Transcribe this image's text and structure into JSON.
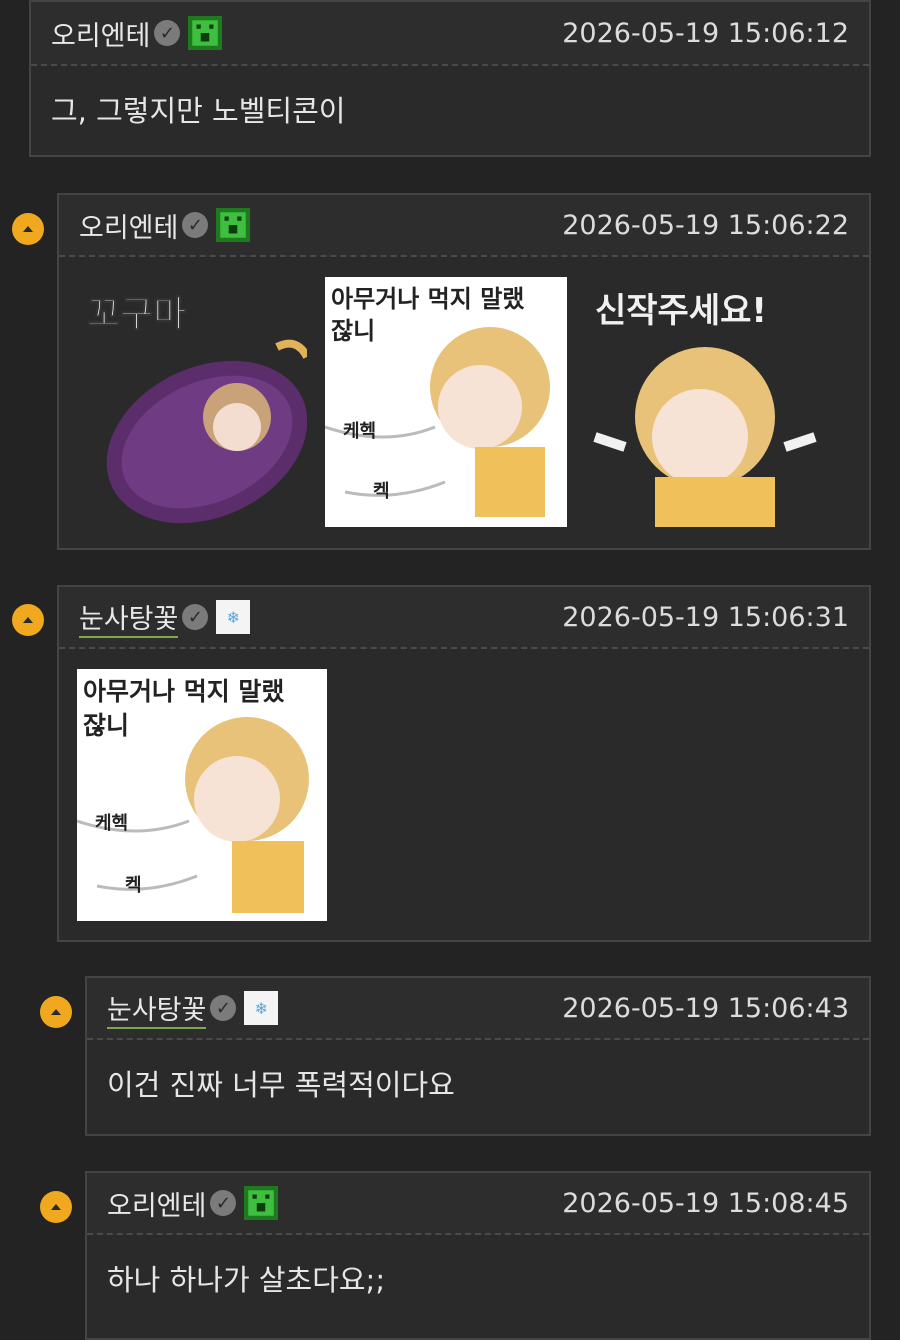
{
  "comments": [
    {
      "author": "오리엔테",
      "time": "2026-05-19 15:06:12",
      "text": "그, 그렇지만 노벨티콘이"
    },
    {
      "author": "오리엔테",
      "time": "2026-05-19 15:06:22",
      "stickers": [
        {
          "name": "sweet-potato-sticker",
          "label": "꼬구마"
        },
        {
          "name": "choking-sticker",
          "label": "아무거나 먹지 말랬잖니",
          "sfx1": "케헥",
          "sfx2": "켁"
        },
        {
          "name": "give-new-sticker",
          "label": "신작주세요!"
        }
      ]
    },
    {
      "author": "눈사탕꽃",
      "time": "2026-05-19 15:06:31",
      "stickers": [
        {
          "name": "choking-sticker",
          "label": "아무거나 먹지 말랬잖니",
          "sfx1": "케헥",
          "sfx2": "켁"
        }
      ]
    },
    {
      "author": "눈사탕꽃",
      "time": "2026-05-19 15:06:43",
      "text": "이건 진짜 너무 폭력적이다요"
    },
    {
      "author": "오리엔테",
      "time": "2026-05-19 15:08:45",
      "text": "하나 하나가 살초다요;;"
    }
  ],
  "colors": {
    "accent": "#f0a81e",
    "background": "#232323",
    "panel": "#2a2a2a"
  },
  "icons": {
    "verified": "check-circle-icon",
    "green_badge": "green-pixel-badge-icon",
    "snow_badge": "snowflake-badge-icon",
    "reply": "reply-arrow-icon"
  }
}
